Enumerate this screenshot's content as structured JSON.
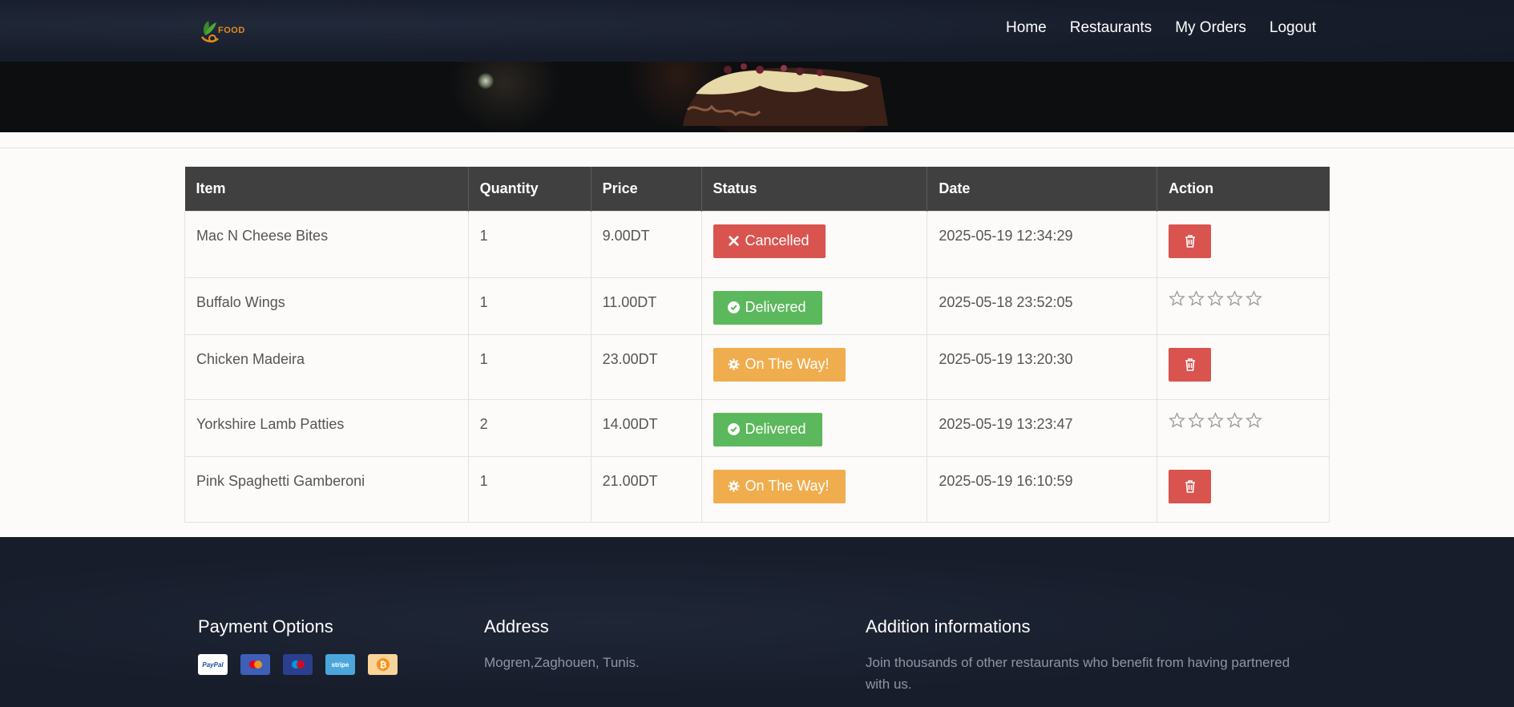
{
  "header": {
    "logo_text": "FOOD",
    "nav": [
      {
        "label": "Home"
      },
      {
        "label": "Restaurants"
      },
      {
        "label": "My Orders"
      },
      {
        "label": "Logout"
      }
    ]
  },
  "table": {
    "columns": [
      "Item",
      "Quantity",
      "Price",
      "Status",
      "Date",
      "Action"
    ],
    "rows": [
      {
        "item": "Mac N Cheese Bites",
        "quantity": "1",
        "price": "9.00DT",
        "status": "Cancelled",
        "date": "2025-05-19 12:34:29",
        "action": "delete"
      },
      {
        "item": "Buffalo Wings",
        "quantity": "1",
        "price": "11.00DT",
        "status": "Delivered",
        "date": "2025-05-18 23:52:05",
        "action": "rate",
        "rating": 0
      },
      {
        "item": "Chicken Madeira",
        "quantity": "1",
        "price": "23.00DT",
        "status": "On The Way!",
        "date": "2025-05-19 13:20:30",
        "action": "delete"
      },
      {
        "item": "Yorkshire Lamb Patties",
        "quantity": "2",
        "price": "14.00DT",
        "status": "Delivered",
        "date": "2025-05-19 13:23:47",
        "action": "rate",
        "rating": 0
      },
      {
        "item": "Pink Spaghetti Gamberoni",
        "quantity": "1",
        "price": "21.00DT",
        "status": "On The Way!",
        "date": "2025-05-19 16:10:59",
        "action": "delete"
      }
    ]
  },
  "status_colors": {
    "cancelled": "#d9534f",
    "delivered": "#5cb85c",
    "on_the_way": "#f0ad4e"
  },
  "footer": {
    "payment": {
      "title": "Payment Options",
      "methods": [
        "PayPal",
        "stripe"
      ]
    },
    "address": {
      "title": "Address",
      "text": "Mogren,Zaghouen, Tunis."
    },
    "info": {
      "title": "Addition informations",
      "text": "Join thousands of other restaurants who benefit from having partnered with us."
    }
  }
}
